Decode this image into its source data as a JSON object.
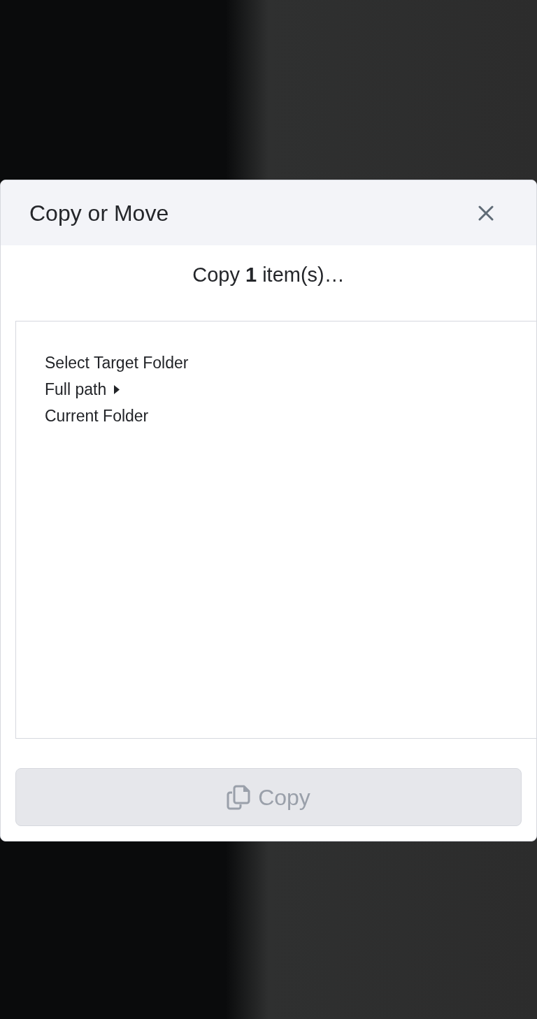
{
  "dialog": {
    "title": "Copy or Move"
  },
  "summary": "Copy **1** item(s)…",
  "folder_panel": {
    "lines": [
      {
        "kind": "label",
        "text": "Select Target Folder"
      },
      {
        "kind": "toggle",
        "text": "Full path",
        "expanded": false
      },
      {
        "kind": "label",
        "text": "Current Folder"
      }
    ]
  },
  "action_button": {
    "label": "Copy",
    "disabled": true
  }
}
